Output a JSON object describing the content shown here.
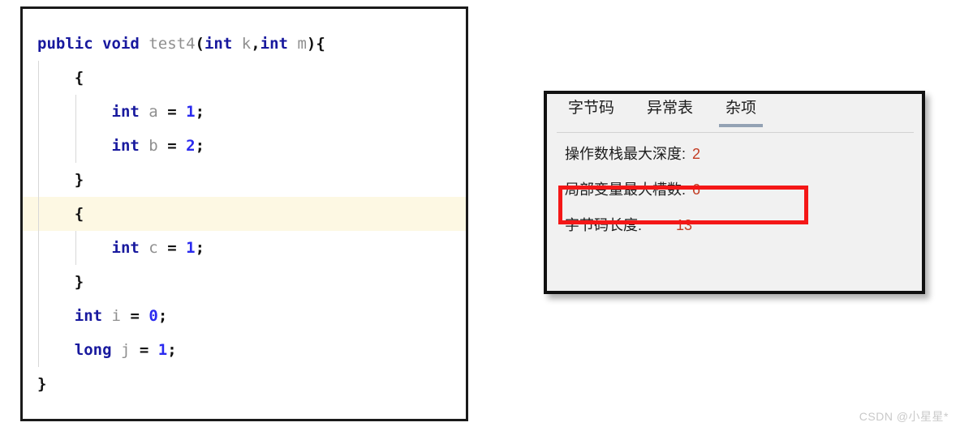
{
  "editor": {
    "highlighted_line_index": 5,
    "lines": [
      {
        "indent": 0,
        "tokens": [
          {
            "t": "public",
            "c": "kw"
          },
          {
            "t": " ",
            "c": "plain"
          },
          {
            "t": "void",
            "c": "kw"
          },
          {
            "t": " ",
            "c": "plain"
          },
          {
            "t": "test4",
            "c": "id"
          },
          {
            "t": "(",
            "c": "pun"
          },
          {
            "t": "int",
            "c": "kw"
          },
          {
            "t": " ",
            "c": "plain"
          },
          {
            "t": "k",
            "c": "id"
          },
          {
            "t": ",",
            "c": "pun"
          },
          {
            "t": "int",
            "c": "kw"
          },
          {
            "t": " ",
            "c": "plain"
          },
          {
            "t": "m",
            "c": "id"
          },
          {
            "t": ")",
            "c": "pun"
          },
          {
            "t": "{",
            "c": "pun"
          }
        ]
      },
      {
        "indent": 1,
        "tokens": [
          {
            "t": "{",
            "c": "pun"
          }
        ]
      },
      {
        "indent": 2,
        "tokens": [
          {
            "t": "int",
            "c": "kw"
          },
          {
            "t": " ",
            "c": "plain"
          },
          {
            "t": "a",
            "c": "id"
          },
          {
            "t": " ",
            "c": "plain"
          },
          {
            "t": "=",
            "c": "pun"
          },
          {
            "t": " ",
            "c": "plain"
          },
          {
            "t": "1",
            "c": "num"
          },
          {
            "t": ";",
            "c": "pun"
          }
        ]
      },
      {
        "indent": 2,
        "tokens": [
          {
            "t": "int",
            "c": "kw"
          },
          {
            "t": " ",
            "c": "plain"
          },
          {
            "t": "b",
            "c": "id"
          },
          {
            "t": " ",
            "c": "plain"
          },
          {
            "t": "=",
            "c": "pun"
          },
          {
            "t": " ",
            "c": "plain"
          },
          {
            "t": "2",
            "c": "num"
          },
          {
            "t": ";",
            "c": "pun"
          }
        ]
      },
      {
        "indent": 1,
        "tokens": [
          {
            "t": "}",
            "c": "pun"
          }
        ]
      },
      {
        "indent": 1,
        "tokens": [
          {
            "t": "{",
            "c": "pun"
          }
        ]
      },
      {
        "indent": 2,
        "tokens": [
          {
            "t": "int",
            "c": "kw"
          },
          {
            "t": " ",
            "c": "plain"
          },
          {
            "t": "c",
            "c": "id"
          },
          {
            "t": " ",
            "c": "plain"
          },
          {
            "t": "=",
            "c": "pun"
          },
          {
            "t": " ",
            "c": "plain"
          },
          {
            "t": "1",
            "c": "num"
          },
          {
            "t": ";",
            "c": "pun"
          }
        ]
      },
      {
        "indent": 1,
        "tokens": [
          {
            "t": "}",
            "c": "pun"
          }
        ]
      },
      {
        "indent": 1,
        "tokens": [
          {
            "t": "int",
            "c": "kw"
          },
          {
            "t": " ",
            "c": "plain"
          },
          {
            "t": "i",
            "c": "id"
          },
          {
            "t": " ",
            "c": "plain"
          },
          {
            "t": "=",
            "c": "pun"
          },
          {
            "t": " ",
            "c": "plain"
          },
          {
            "t": "0",
            "c": "num"
          },
          {
            "t": ";",
            "c": "pun"
          }
        ]
      },
      {
        "indent": 1,
        "tokens": [
          {
            "t": "long",
            "c": "kw"
          },
          {
            "t": " ",
            "c": "plain"
          },
          {
            "t": "j",
            "c": "id"
          },
          {
            "t": " ",
            "c": "plain"
          },
          {
            "t": "=",
            "c": "pun"
          },
          {
            "t": " ",
            "c": "plain"
          },
          {
            "t": "1",
            "c": "num"
          },
          {
            "t": ";",
            "c": "pun"
          }
        ]
      },
      {
        "indent": 0,
        "tokens": [
          {
            "t": "}",
            "c": "pun"
          }
        ]
      }
    ],
    "colors": {
      "keyword": "#18199e",
      "identifier": "#8f8f8f",
      "number": "#2a2af0",
      "punctuation": "#111111",
      "highlight_line_bg": "#fdf8e3",
      "border": "#1a1a1a"
    }
  },
  "info_panel": {
    "tabs": [
      {
        "label": "字节码",
        "active": false
      },
      {
        "label": "异常表",
        "active": false
      },
      {
        "label": "杂项",
        "active": true
      }
    ],
    "rows": [
      {
        "label": "操作数栈最大深度:",
        "value": "2",
        "highlighted": false,
        "wide_gap": false
      },
      {
        "label": "局部变量最大槽数:",
        "value": "6",
        "highlighted": true,
        "wide_gap": false
      },
      {
        "label": "字节码长度:",
        "value": "13",
        "highlighted": false,
        "wide_gap": true
      }
    ],
    "colors": {
      "value": "#c23b22",
      "highlight_box": "#f41717",
      "active_tab_underline": "#93a2b4",
      "panel_bg": "#f1f1f1",
      "panel_border": "#111111"
    }
  },
  "watermark": {
    "text": "CSDN @小星星*"
  }
}
